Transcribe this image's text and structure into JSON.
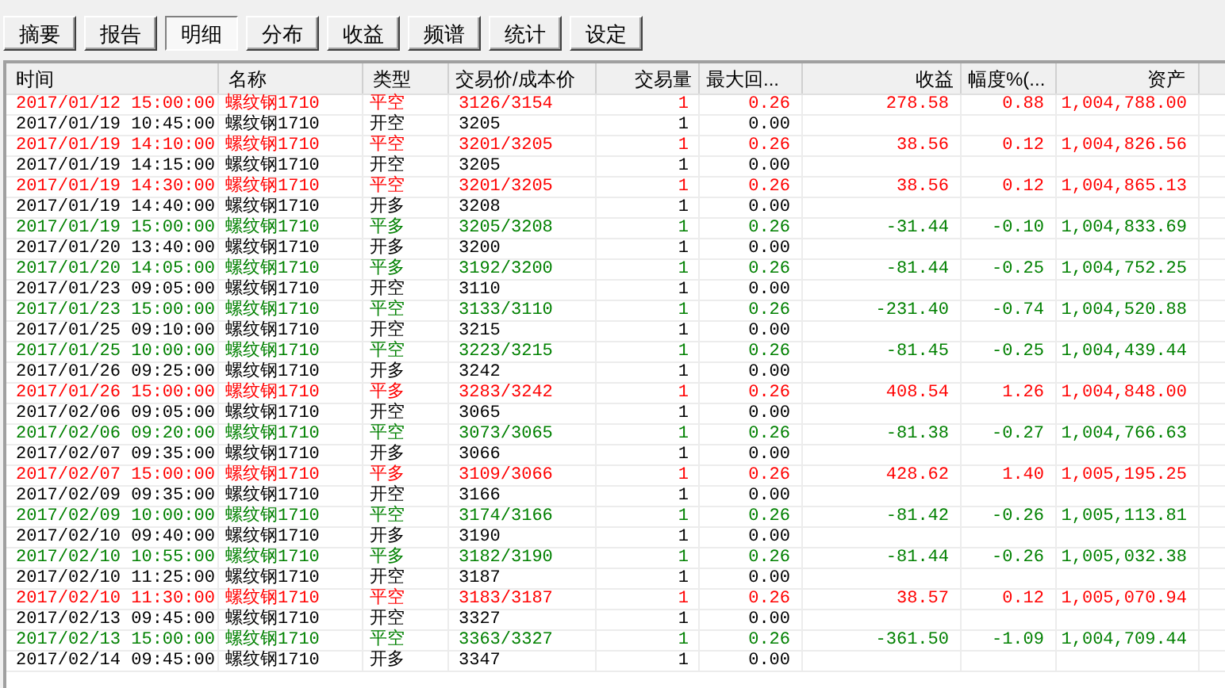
{
  "tabs": [
    {
      "label": "摘要",
      "selected": false
    },
    {
      "label": "报告",
      "selected": false
    },
    {
      "label": "明细",
      "selected": true
    },
    {
      "label": "分布",
      "selected": false
    },
    {
      "label": "收益",
      "selected": false
    },
    {
      "label": "频谱",
      "selected": false
    },
    {
      "label": "统计",
      "selected": false
    },
    {
      "label": "设定",
      "selected": false
    }
  ],
  "table": {
    "columns": [
      "时间",
      "名称",
      "类型",
      "交易价/成本价",
      "交易量",
      "最大回...",
      "收益",
      "幅度%(...",
      "资产"
    ],
    "rows": [
      {
        "kind": "win",
        "time": "2017/01/12 15:00:00",
        "name": "螺纹钢1710",
        "type": "平空",
        "price": "3126/3154",
        "qty": "1",
        "drawdown": "0.26",
        "profit": "278.58",
        "pct": "0.88",
        "asset": "1,004,788.00"
      },
      {
        "kind": "open",
        "time": "2017/01/19 10:45:00",
        "name": "螺纹钢1710",
        "type": "开空",
        "price": "3205",
        "qty": "1",
        "drawdown": "0.00"
      },
      {
        "kind": "win",
        "time": "2017/01/19 14:10:00",
        "name": "螺纹钢1710",
        "type": "平空",
        "price": "3201/3205",
        "qty": "1",
        "drawdown": "0.26",
        "profit": "38.56",
        "pct": "0.12",
        "asset": "1,004,826.56"
      },
      {
        "kind": "open",
        "time": "2017/01/19 14:15:00",
        "name": "螺纹钢1710",
        "type": "开空",
        "price": "3205",
        "qty": "1",
        "drawdown": "0.00"
      },
      {
        "kind": "win",
        "time": "2017/01/19 14:30:00",
        "name": "螺纹钢1710",
        "type": "平空",
        "price": "3201/3205",
        "qty": "1",
        "drawdown": "0.26",
        "profit": "38.56",
        "pct": "0.12",
        "asset": "1,004,865.13"
      },
      {
        "kind": "open",
        "time": "2017/01/19 14:40:00",
        "name": "螺纹钢1710",
        "type": "开多",
        "price": "3208",
        "qty": "1",
        "drawdown": "0.00"
      },
      {
        "kind": "loss",
        "time": "2017/01/19 15:00:00",
        "name": "螺纹钢1710",
        "type": "平多",
        "price": "3205/3208",
        "qty": "1",
        "drawdown": "0.26",
        "profit": "-31.44",
        "pct": "-0.10",
        "asset": "1,004,833.69"
      },
      {
        "kind": "open",
        "time": "2017/01/20 13:40:00",
        "name": "螺纹钢1710",
        "type": "开多",
        "price": "3200",
        "qty": "1",
        "drawdown": "0.00"
      },
      {
        "kind": "loss",
        "time": "2017/01/20 14:05:00",
        "name": "螺纹钢1710",
        "type": "平多",
        "price": "3192/3200",
        "qty": "1",
        "drawdown": "0.26",
        "profit": "-81.44",
        "pct": "-0.25",
        "asset": "1,004,752.25"
      },
      {
        "kind": "open",
        "time": "2017/01/23 09:05:00",
        "name": "螺纹钢1710",
        "type": "开空",
        "price": "3110",
        "qty": "1",
        "drawdown": "0.00"
      },
      {
        "kind": "loss",
        "time": "2017/01/23 15:00:00",
        "name": "螺纹钢1710",
        "type": "平空",
        "price": "3133/3110",
        "qty": "1",
        "drawdown": "0.26",
        "profit": "-231.40",
        "pct": "-0.74",
        "asset": "1,004,520.88"
      },
      {
        "kind": "open",
        "time": "2017/01/25 09:10:00",
        "name": "螺纹钢1710",
        "type": "开空",
        "price": "3215",
        "qty": "1",
        "drawdown": "0.00"
      },
      {
        "kind": "loss",
        "time": "2017/01/25 10:00:00",
        "name": "螺纹钢1710",
        "type": "平空",
        "price": "3223/3215",
        "qty": "1",
        "drawdown": "0.26",
        "profit": "-81.45",
        "pct": "-0.25",
        "asset": "1,004,439.44"
      },
      {
        "kind": "open",
        "time": "2017/01/26 09:25:00",
        "name": "螺纹钢1710",
        "type": "开多",
        "price": "3242",
        "qty": "1",
        "drawdown": "0.00"
      },
      {
        "kind": "win",
        "time": "2017/01/26 15:00:00",
        "name": "螺纹钢1710",
        "type": "平多",
        "price": "3283/3242",
        "qty": "1",
        "drawdown": "0.26",
        "profit": "408.54",
        "pct": "1.26",
        "asset": "1,004,848.00"
      },
      {
        "kind": "open",
        "time": "2017/02/06 09:05:00",
        "name": "螺纹钢1710",
        "type": "开空",
        "price": "3065",
        "qty": "1",
        "drawdown": "0.00"
      },
      {
        "kind": "loss",
        "time": "2017/02/06 09:20:00",
        "name": "螺纹钢1710",
        "type": "平空",
        "price": "3073/3065",
        "qty": "1",
        "drawdown": "0.26",
        "profit": "-81.38",
        "pct": "-0.27",
        "asset": "1,004,766.63"
      },
      {
        "kind": "open",
        "time": "2017/02/07 09:35:00",
        "name": "螺纹钢1710",
        "type": "开多",
        "price": "3066",
        "qty": "1",
        "drawdown": "0.00"
      },
      {
        "kind": "win",
        "time": "2017/02/07 15:00:00",
        "name": "螺纹钢1710",
        "type": "平多",
        "price": "3109/3066",
        "qty": "1",
        "drawdown": "0.26",
        "profit": "428.62",
        "pct": "1.40",
        "asset": "1,005,195.25"
      },
      {
        "kind": "open",
        "time": "2017/02/09 09:35:00",
        "name": "螺纹钢1710",
        "type": "开空",
        "price": "3166",
        "qty": "1",
        "drawdown": "0.00"
      },
      {
        "kind": "loss",
        "time": "2017/02/09 10:00:00",
        "name": "螺纹钢1710",
        "type": "平空",
        "price": "3174/3166",
        "qty": "1",
        "drawdown": "0.26",
        "profit": "-81.42",
        "pct": "-0.26",
        "asset": "1,005,113.81"
      },
      {
        "kind": "open",
        "time": "2017/02/10 09:40:00",
        "name": "螺纹钢1710",
        "type": "开多",
        "price": "3190",
        "qty": "1",
        "drawdown": "0.00"
      },
      {
        "kind": "loss",
        "time": "2017/02/10 10:55:00",
        "name": "螺纹钢1710",
        "type": "平多",
        "price": "3182/3190",
        "qty": "1",
        "drawdown": "0.26",
        "profit": "-81.44",
        "pct": "-0.26",
        "asset": "1,005,032.38"
      },
      {
        "kind": "open",
        "time": "2017/02/10 11:25:00",
        "name": "螺纹钢1710",
        "type": "开空",
        "price": "3187",
        "qty": "1",
        "drawdown": "0.00"
      },
      {
        "kind": "win",
        "time": "2017/02/10 11:30:00",
        "name": "螺纹钢1710",
        "type": "平空",
        "price": "3183/3187",
        "qty": "1",
        "drawdown": "0.26",
        "profit": "38.57",
        "pct": "0.12",
        "asset": "1,005,070.94"
      },
      {
        "kind": "open",
        "time": "2017/02/13 09:45:00",
        "name": "螺纹钢1710",
        "type": "开空",
        "price": "3327",
        "qty": "1",
        "drawdown": "0.00"
      },
      {
        "kind": "loss",
        "time": "2017/02/13 15:00:00",
        "name": "螺纹钢1710",
        "type": "平空",
        "price": "3363/3327",
        "qty": "1",
        "drawdown": "0.26",
        "profit": "-361.50",
        "pct": "-1.09",
        "asset": "1,004,709.44"
      },
      {
        "kind": "open",
        "time": "2017/02/14 09:45:00",
        "name": "螺纹钢1710",
        "type": "开多",
        "price": "3347",
        "qty": "1",
        "drawdown": "0.00"
      }
    ]
  }
}
